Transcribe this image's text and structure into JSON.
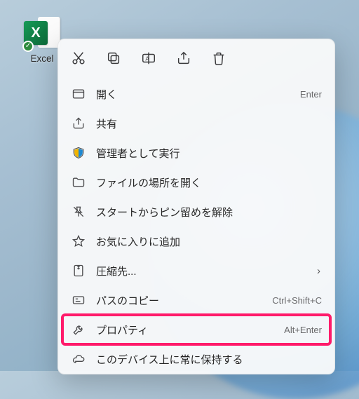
{
  "desktop": {
    "icon_label": "Excel"
  },
  "toolbar": {
    "cut": "cut-icon",
    "copy": "copy-icon",
    "rename": "rename-icon",
    "share": "share-icon",
    "delete": "delete-icon"
  },
  "menu": {
    "items": [
      {
        "id": "open",
        "icon": "app-window-icon",
        "label": "開く",
        "shortcut": "Enter",
        "has_sub": false,
        "selected": false
      },
      {
        "id": "share",
        "icon": "share-icon",
        "label": "共有",
        "shortcut": "",
        "has_sub": false,
        "selected": false
      },
      {
        "id": "runadmin",
        "icon": "shield-icon",
        "label": "管理者として実行",
        "shortcut": "",
        "has_sub": false,
        "selected": false
      },
      {
        "id": "folder",
        "icon": "folder-icon",
        "label": "ファイルの場所を開く",
        "shortcut": "",
        "has_sub": false,
        "selected": false
      },
      {
        "id": "unpin",
        "icon": "unpin-icon",
        "label": "スタートからピン留めを解除",
        "shortcut": "",
        "has_sub": false,
        "selected": false
      },
      {
        "id": "favorite",
        "icon": "star-icon",
        "label": "お気に入りに追加",
        "shortcut": "",
        "has_sub": false,
        "selected": false
      },
      {
        "id": "compress",
        "icon": "zip-icon",
        "label": "圧縮先...",
        "shortcut": "",
        "has_sub": true,
        "selected": false
      },
      {
        "id": "copypath",
        "icon": "copypath-icon",
        "label": "パスのコピー",
        "shortcut": "Ctrl+Shift+C",
        "has_sub": false,
        "selected": false
      },
      {
        "id": "properties",
        "icon": "wrench-icon",
        "label": "プロパティ",
        "shortcut": "Alt+Enter",
        "has_sub": false,
        "selected": true
      },
      {
        "id": "keepdevice",
        "icon": "cloud-icon",
        "label": "このデバイス上に常に保持する",
        "shortcut": "",
        "has_sub": false,
        "selected": false
      }
    ]
  }
}
